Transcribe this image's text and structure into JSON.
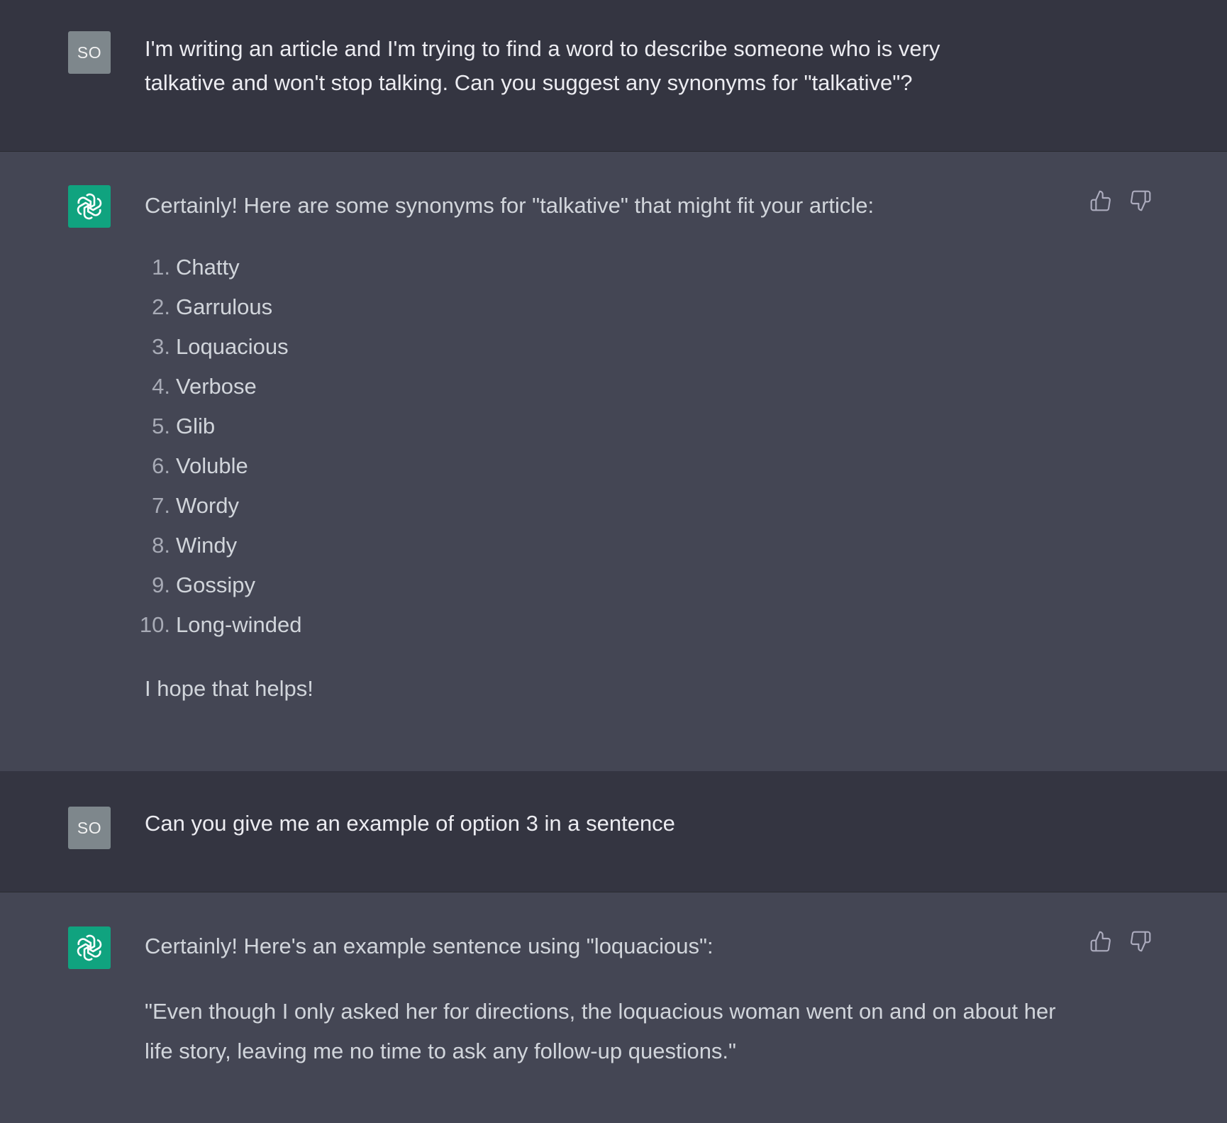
{
  "conversation": {
    "user_initials": "SO",
    "messages": [
      {
        "role": "user",
        "text": "I'm writing an article and I'm trying to find a word to describe someone who is very talkative and won't stop talking. Can you suggest any synonyms for \"talkative\"?"
      },
      {
        "role": "assistant",
        "intro": "Certainly! Here are some synonyms for \"talkative\" that might fit your article:",
        "list": [
          {
            "num": "1.",
            "word": "Chatty"
          },
          {
            "num": "2.",
            "word": "Garrulous"
          },
          {
            "num": "3.",
            "word": "Loquacious"
          },
          {
            "num": "4.",
            "word": "Verbose"
          },
          {
            "num": "5.",
            "word": "Glib"
          },
          {
            "num": "6.",
            "word": "Voluble"
          },
          {
            "num": "7.",
            "word": "Wordy"
          },
          {
            "num": "8.",
            "word": "Windy"
          },
          {
            "num": "9.",
            "word": "Gossipy"
          },
          {
            "num": "10.",
            "word": "Long-winded"
          }
        ],
        "outro": "I hope that helps!"
      },
      {
        "role": "user",
        "text": "Can you give me an example of option 3 in a sentence"
      },
      {
        "role": "assistant",
        "intro": "Certainly! Here's an example sentence using \"loquacious\":",
        "body": "\"Even though I only asked her for directions, the loquacious woman went on and on about her life story, leaving me no time to ask any follow-up questions.\""
      }
    ]
  },
  "icons": {
    "assistant_avatar": "openai-logo-icon",
    "thumbs_up": "thumbs-up-icon",
    "thumbs_down": "thumbs-down-icon"
  },
  "colors": {
    "user_bg": "#343541",
    "assistant_bg": "#444654",
    "assistant_avatar_bg": "#10a37f",
    "user_avatar_bg": "#7e878c"
  }
}
